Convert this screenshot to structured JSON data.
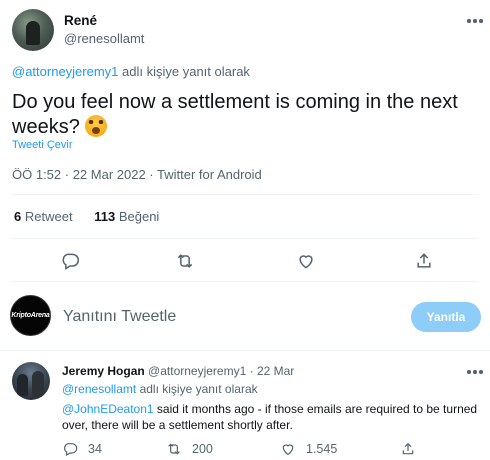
{
  "tweet": {
    "author_name": "René",
    "author_handle": "@renesollamt",
    "reply_to_handle": "@attorneyjeremy1",
    "reply_to_suffix": "adlı kişiye yanıt olarak",
    "text": "Do you feel now a settlement is coming in the next weeks?",
    "emoji": "astonished-face",
    "translate_label": "Tweeti Çevir",
    "timestamp": "ÖÖ 1:52 · 22 Mar 2022 · Twitter for Android",
    "retweet_count": "6",
    "retweet_label": "Retweet",
    "like_count": "113",
    "like_label": "Beğeni"
  },
  "actions": {
    "icons": [
      "reply-icon",
      "retweet-icon",
      "like-icon",
      "share-icon"
    ]
  },
  "compose": {
    "avatar_text": "KriptoArena",
    "placeholder": "Yanıtını Tweetle",
    "reply_button_label": "Yanıtla",
    "reply_button_color": "#8ecdf8"
  },
  "reply": {
    "author_name": "Jeremy Hogan",
    "author_handle": "@attorneyjeremy1",
    "date": "· 22 Mar",
    "reply_to_handle": "@renesollamt",
    "reply_to_suffix": "adlı kişiye yanıt olarak",
    "mention": "@JohnEDeaton1",
    "text": " said it months ago - if those emails are required to be turned over, there will be a settlement shortly after.",
    "reply_count": "34",
    "retweet_count": "200",
    "like_count": "1.545"
  },
  "colors": {
    "accent": "#1d9bf0",
    "muted": "#536471",
    "text": "#0f1419",
    "divider": "#eff3f4"
  }
}
